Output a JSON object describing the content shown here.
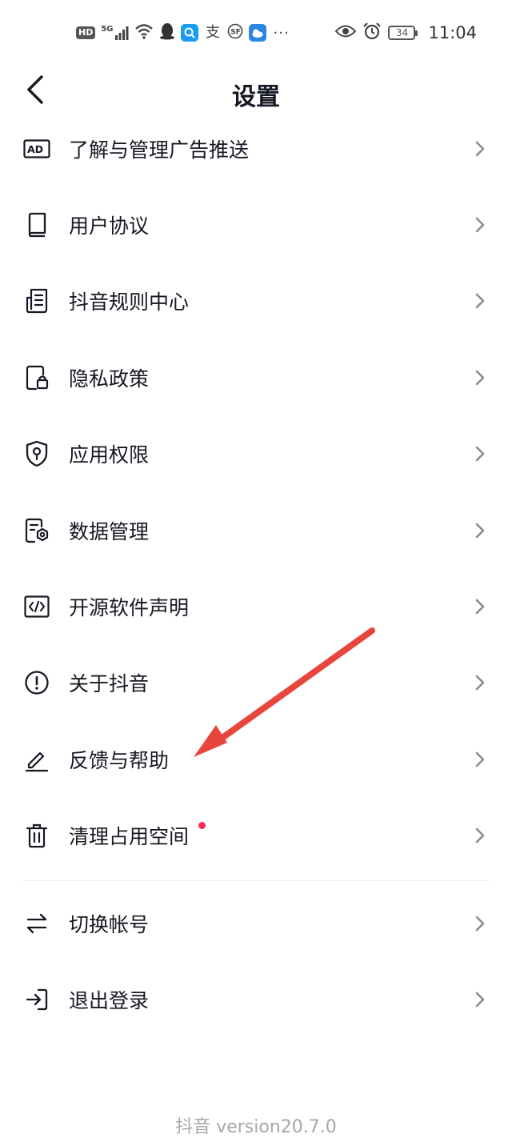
{
  "status_bar": {
    "hd": "HD",
    "network": "5G",
    "time": "11:04",
    "battery": "34",
    "more": "···"
  },
  "nav": {
    "title": "设置",
    "back_icon": "back-arrow-icon"
  },
  "menu": [
    {
      "label": "了解与管理广告推送",
      "icon": "ad-icon"
    },
    {
      "label": "用户协议",
      "icon": "book-icon"
    },
    {
      "label": "抖音规则中心",
      "icon": "rules-document-icon"
    },
    {
      "label": "隐私政策",
      "icon": "privacy-lock-icon"
    },
    {
      "label": "应用权限",
      "icon": "shield-icon"
    },
    {
      "label": "数据管理",
      "icon": "data-settings-icon"
    },
    {
      "label": "开源软件声明",
      "icon": "code-icon"
    },
    {
      "label": "关于抖音",
      "icon": "info-exclamation-icon"
    },
    {
      "label": "反馈与帮助",
      "icon": "pencil-icon"
    },
    {
      "label": "清理占用空间",
      "icon": "trash-icon",
      "badge_dot": true
    }
  ],
  "menu2": [
    {
      "label": "切换帐号",
      "icon": "switch-arrows-icon"
    },
    {
      "label": "退出登录",
      "icon": "logout-icon"
    }
  ],
  "footer": {
    "version": "抖音 version20.7.0"
  },
  "colors": {
    "text": "#161823",
    "dot": "#fe2c55",
    "annotation_arrow": "#e8453c",
    "version": "#a7a7ab"
  }
}
